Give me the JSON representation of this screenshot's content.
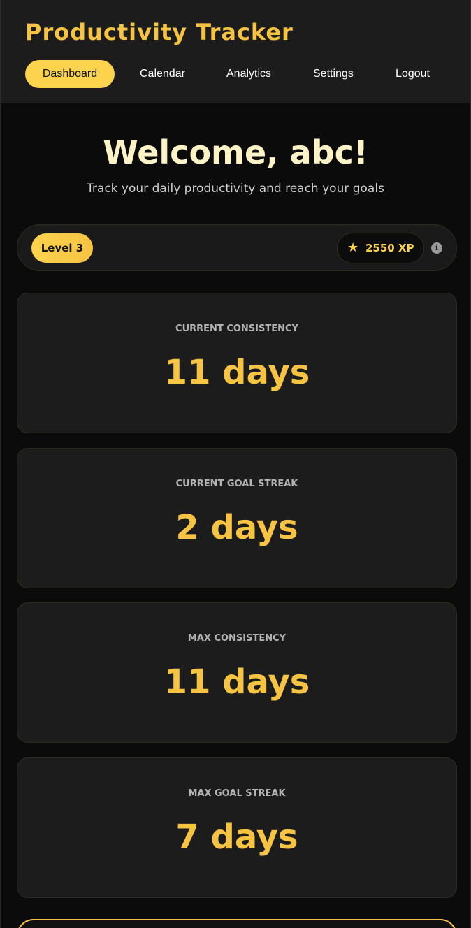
{
  "app": {
    "title": "Productivity Tracker"
  },
  "nav": {
    "items": [
      {
        "label": "Dashboard",
        "active": true
      },
      {
        "label": "Calendar",
        "active": false
      },
      {
        "label": "Analytics",
        "active": false
      },
      {
        "label": "Settings",
        "active": false
      },
      {
        "label": "Logout",
        "active": false
      }
    ]
  },
  "welcome": {
    "heading": "Welcome, abc!",
    "subtitle": "Track your daily productivity and reach your goals"
  },
  "level": {
    "label": "Level 3",
    "xp": "2550 XP",
    "star_icon": "star-icon",
    "info_icon": "info-icon"
  },
  "stats": [
    {
      "label": "CURRENT CONSISTENCY",
      "value": "11 days"
    },
    {
      "label": "CURRENT GOAL STREAK",
      "value": "2 days"
    },
    {
      "label": "MAX CONSISTENCY",
      "value": "11 days"
    },
    {
      "label": "MAX GOAL STREAK",
      "value": "7 days"
    }
  ],
  "colors": {
    "accent": "#f6c343",
    "accent_light": "#fcd34d",
    "background": "#0b0b0b",
    "card": "#1c1c1c"
  }
}
